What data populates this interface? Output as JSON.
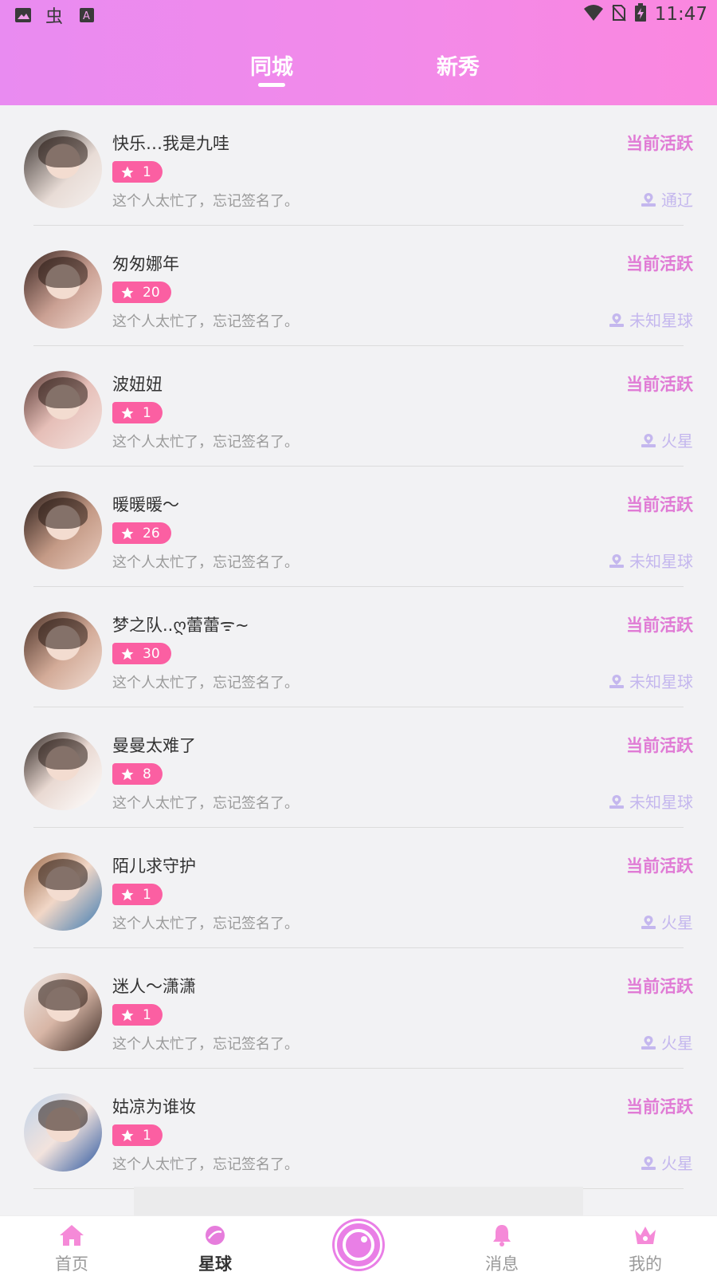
{
  "status_bar": {
    "time": "11:47"
  },
  "tabs": [
    {
      "label": "同城",
      "selected": true
    },
    {
      "label": "新秀",
      "selected": false
    }
  ],
  "users": [
    {
      "name": "快乐…我是九哇",
      "status": "当前活跃",
      "level": "1",
      "signature": "这个人太忙了，忘记签名了。",
      "location": "通辽"
    },
    {
      "name": "匆匆娜年",
      "status": "当前活跃",
      "level": "20",
      "signature": "这个人太忙了，忘记签名了。",
      "location": "未知星球"
    },
    {
      "name": "波妞妞",
      "status": "当前活跃",
      "level": "1",
      "signature": "这个人太忙了，忘记签名了。",
      "location": "火星"
    },
    {
      "name": "暖暖暖～",
      "status": "当前活跃",
      "level": "26",
      "signature": "这个人太忙了，忘记签名了。",
      "location": "未知星球"
    },
    {
      "name": "梦之队..ღ蕾蕾ᯤ~",
      "status": "当前活跃",
      "level": "30",
      "signature": "这个人太忙了，忘记签名了。",
      "location": "未知星球"
    },
    {
      "name": "曼曼太难了",
      "status": "当前活跃",
      "level": "8",
      "signature": "这个人太忙了，忘记签名了。",
      "location": "未知星球"
    },
    {
      "name": "陌儿求守护",
      "status": "当前活跃",
      "level": "1",
      "signature": "这个人太忙了，忘记签名了。",
      "location": "火星"
    },
    {
      "name": "迷人～潇潇",
      "status": "当前活跃",
      "level": "1",
      "signature": "这个人太忙了，忘记签名了。",
      "location": "火星"
    },
    {
      "name": "姑凉为谁妆",
      "status": "当前活跃",
      "level": "1",
      "signature": "这个人太忙了，忘记签名了。",
      "location": "火星"
    }
  ],
  "bottom_nav": [
    {
      "label": "首页",
      "icon": "home-icon",
      "active": false
    },
    {
      "label": "星球",
      "icon": "planet-icon",
      "active": true
    },
    {
      "label": "",
      "icon": "camera-icon",
      "active": false
    },
    {
      "label": "消息",
      "icon": "bell-icon",
      "active": false
    },
    {
      "label": "我的",
      "icon": "crown-icon",
      "active": false
    }
  ],
  "colors": {
    "header_gradient_start": "#e98bf1",
    "header_gradient_end": "#fb87df",
    "active_status": "#e07bd5",
    "level_badge": "#fb5fa2",
    "location": "#c4b7ee",
    "nav_accent": "#e97fe6"
  }
}
